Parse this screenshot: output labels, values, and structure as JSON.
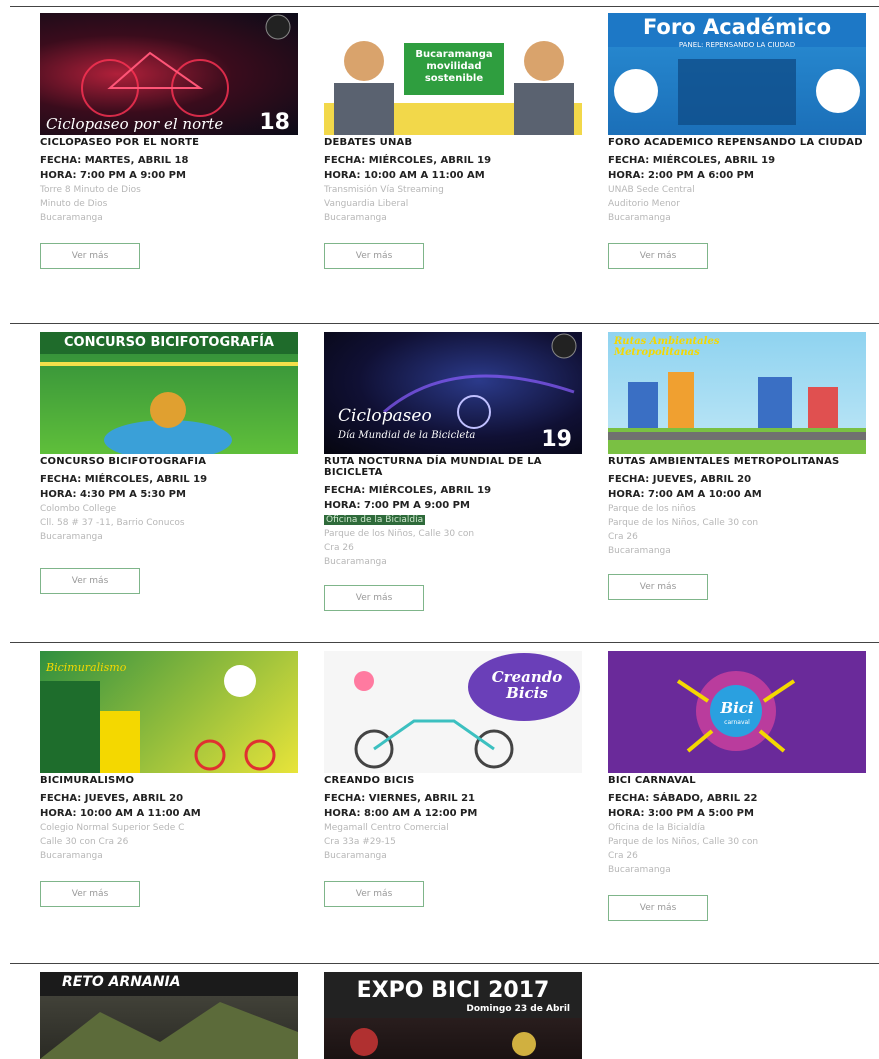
{
  "button_label": "Ver más",
  "events": [
    {
      "title": "CICLOPASEO POR EL NORTE",
      "fecha": "FECHA: MARTES, ABRIL 18",
      "hora": "HORA: 7:00 PM A 9:00 PM",
      "loc": [
        "Torre 8 Minuto de Dios",
        "Minuto de Dios",
        "Bucaramanga"
      ],
      "img_text": "Ciclopaseo por el norte",
      "img_num": "18"
    },
    {
      "title": "DEBATES UNAB",
      "fecha": "FECHA: MIÉRCOLES, ABRIL 19",
      "hora": "HORA: 10:00 AM A 11:00 AM",
      "loc": [
        "Transmisión Vía Streaming",
        "Vanguardia Liberal",
        "Bucaramanga"
      ],
      "img_text": "Bucaramanga movilidad sostenible"
    },
    {
      "title": "FORO ACADEMICO REPENSANDO LA CIUDAD",
      "fecha": "FECHA: MIÉRCOLES, ABRIL 19",
      "hora": "HORA: 2:00 PM A 6:00 PM",
      "loc": [
        "UNAB Sede Central",
        "Auditorio Menor",
        "Bucaramanga"
      ],
      "img_text": "Foro Académico",
      "img_sub": "PANEL: REPENSANDO LA CIUDAD"
    },
    {
      "title": "CONCURSO BICIFOTOGRAFIA",
      "fecha": "FECHA: MIÉRCOLES, ABRIL 19",
      "hora": "HORA: 4:30 PM A 5:30 PM",
      "loc": [
        "Colombo College",
        "Cll. 58 # 37 -11, Barrio Conucos",
        "Bucaramanga"
      ],
      "img_text": "CONCURSO BICIFOTOGRAFÍA"
    },
    {
      "title": "RUTA NOCTURNA DÍA MUNDIAL DE LA BICICLETA",
      "fecha": "FECHA: MIÉRCOLES, ABRIL 19",
      "hora": "HORA: 7:00 PM A 9:00 PM",
      "highlight": "Oficina de la Bicialdía",
      "loc": [
        "Parque de los Niños, Calle 30 con",
        "Cra 26",
        "Bucaramanga"
      ],
      "img_text": "Ciclopaseo",
      "img_text2": "Día Mundial de la Bicicleta",
      "img_num": "19"
    },
    {
      "title": "RUTAS AMBIENTALES METROPOLITANAS",
      "fecha": "FECHA: JUEVES, ABRIL 20",
      "hora": "HORA: 7:00 AM A 10:00 AM",
      "loc": [
        "Parque de los niños",
        "Parque de los Niños, Calle 30 con",
        "Cra 26",
        "Bucaramanga"
      ],
      "img_text": "Rutas Ambientales Metropolitanas"
    },
    {
      "title": "BICIMURALISMO",
      "fecha": "FECHA: JUEVES, ABRIL 20",
      "hora": "HORA: 10:00 AM A 11:00 AM",
      "loc": [
        "Colegio Normal Superior Sede C",
        "Calle 30 con Cra 26",
        "Bucaramanga"
      ],
      "img_text": "Bicimuralismo"
    },
    {
      "title": "CREANDO BICIS",
      "fecha": "FECHA: VIERNES, ABRIL 21",
      "hora": "HORA: 8:00 AM A 12:00 PM",
      "loc": [
        "Megamall Centro Comercial",
        "Cra 33a #29-15",
        "Bucaramanga"
      ],
      "img_text": "Creando Bicis"
    },
    {
      "title": "BICI CARNAVAL",
      "fecha": "FECHA: SÁBADO, ABRIL 22",
      "hora": "HORA: 3:00 PM A 5:00 PM",
      "loc": [
        "Oficina de la Bicialdía",
        "Parque de los Niños, Calle 30 con",
        "Cra 26",
        "Bucaramanga"
      ],
      "img_text": "Bici",
      "img_sub": "carnaval"
    },
    {
      "img_text": "RETO ARNANIA"
    },
    {
      "img_text": "EXPO BICI 2017",
      "img_sub": "Domingo 23 de Abril"
    }
  ]
}
